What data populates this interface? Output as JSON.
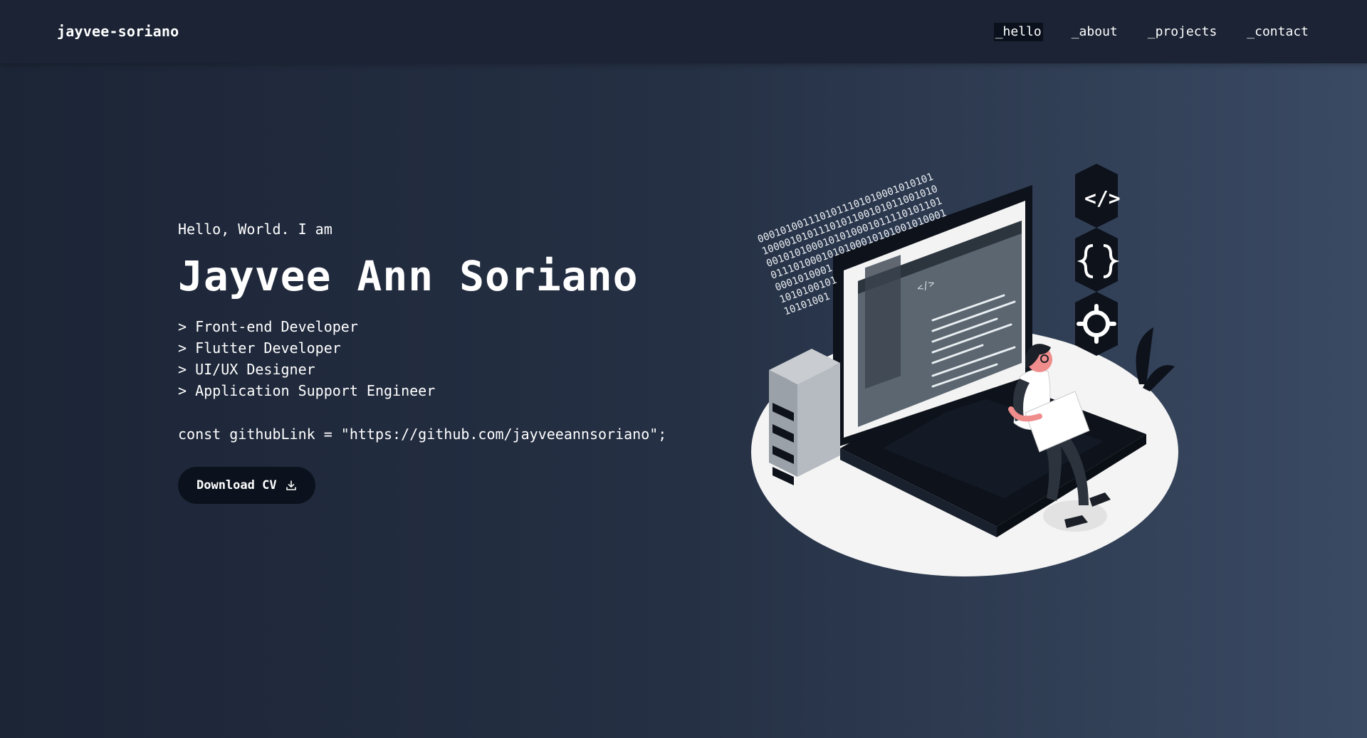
{
  "header": {
    "brand": "jayvee-soriano",
    "nav": [
      {
        "label": "_hello",
        "active": true
      },
      {
        "label": "_about",
        "active": false
      },
      {
        "label": "_projects",
        "active": false
      },
      {
        "label": "_contact",
        "active": false
      }
    ]
  },
  "hero": {
    "greeting": "Hello, World. I am",
    "name": "Jayvee Ann Soriano",
    "roles": [
      "> Front-end Developer",
      "> Flutter Developer",
      "> UI/UX Designer",
      "> Application Support Engineer"
    ],
    "code_line": "const githubLink = \"https://github.com/jayveeannsoriano\";",
    "cv_button": {
      "label": "Download CV",
      "icon": "download-icon"
    }
  },
  "illustration": {
    "binary_lines": [
      "0001010011101011101010001010101",
      "1000010101110101100101011001010",
      "0010101000101010001011110101101",
      "0111010001010100010101001010001",
      "0001010001",
      "1010100101",
      "10101001"
    ],
    "code_tag": "</>",
    "colors": {
      "platform": "#f2f2f2",
      "dark": "#0d121b",
      "screen": "#5b6670",
      "accent": "#ef8c8c"
    }
  }
}
